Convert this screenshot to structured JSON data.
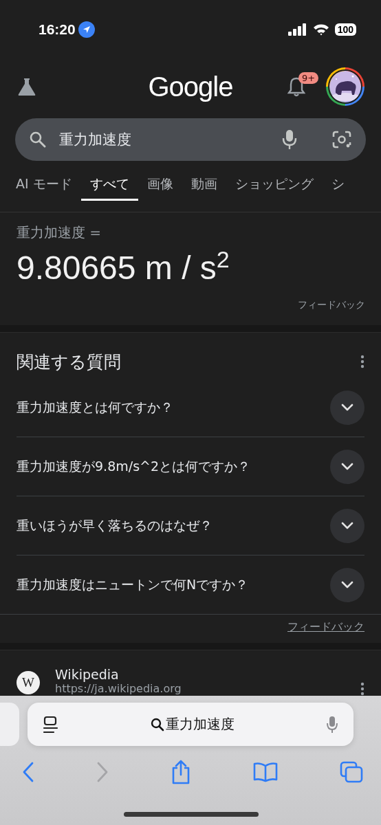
{
  "status_bar": {
    "time": "16:20",
    "battery": "100"
  },
  "header": {
    "logo": "Google",
    "notification_badge": "9+"
  },
  "search": {
    "value": "重力加速度"
  },
  "tabs": [
    {
      "label": "AI モード",
      "selected": false
    },
    {
      "label": "すべて",
      "selected": true
    },
    {
      "label": "画像",
      "selected": false
    },
    {
      "label": "動画",
      "selected": false
    },
    {
      "label": "ショッピング",
      "selected": false
    },
    {
      "label": "シ",
      "selected": false
    }
  ],
  "answer": {
    "label": "重力加速度 =",
    "value": "9.80665 m / s$^{2}$",
    "feedback": "フィードバック"
  },
  "related_questions": {
    "title": "関連する質問",
    "items": [
      {
        "question": "重力加速度とは何ですか？",
        "expanded": false
      },
      {
        "question": "重力加速度が9.8m/s^2とは何ですか？",
        "expanded": false
      },
      {
        "question": "重いほうが早く落ちるのはなぜ？",
        "expanded": false
      },
      {
        "question": "重力加速度はニュートンで何Nですか？",
        "expanded": false
      }
    ],
    "feedback": "フィードバック"
  },
  "result": {
    "logo_letter": "W",
    "site": "Wikipedia",
    "url": "https://ja.wikipedia.org"
  },
  "browser_bar": {
    "address": "重力加速度"
  }
}
